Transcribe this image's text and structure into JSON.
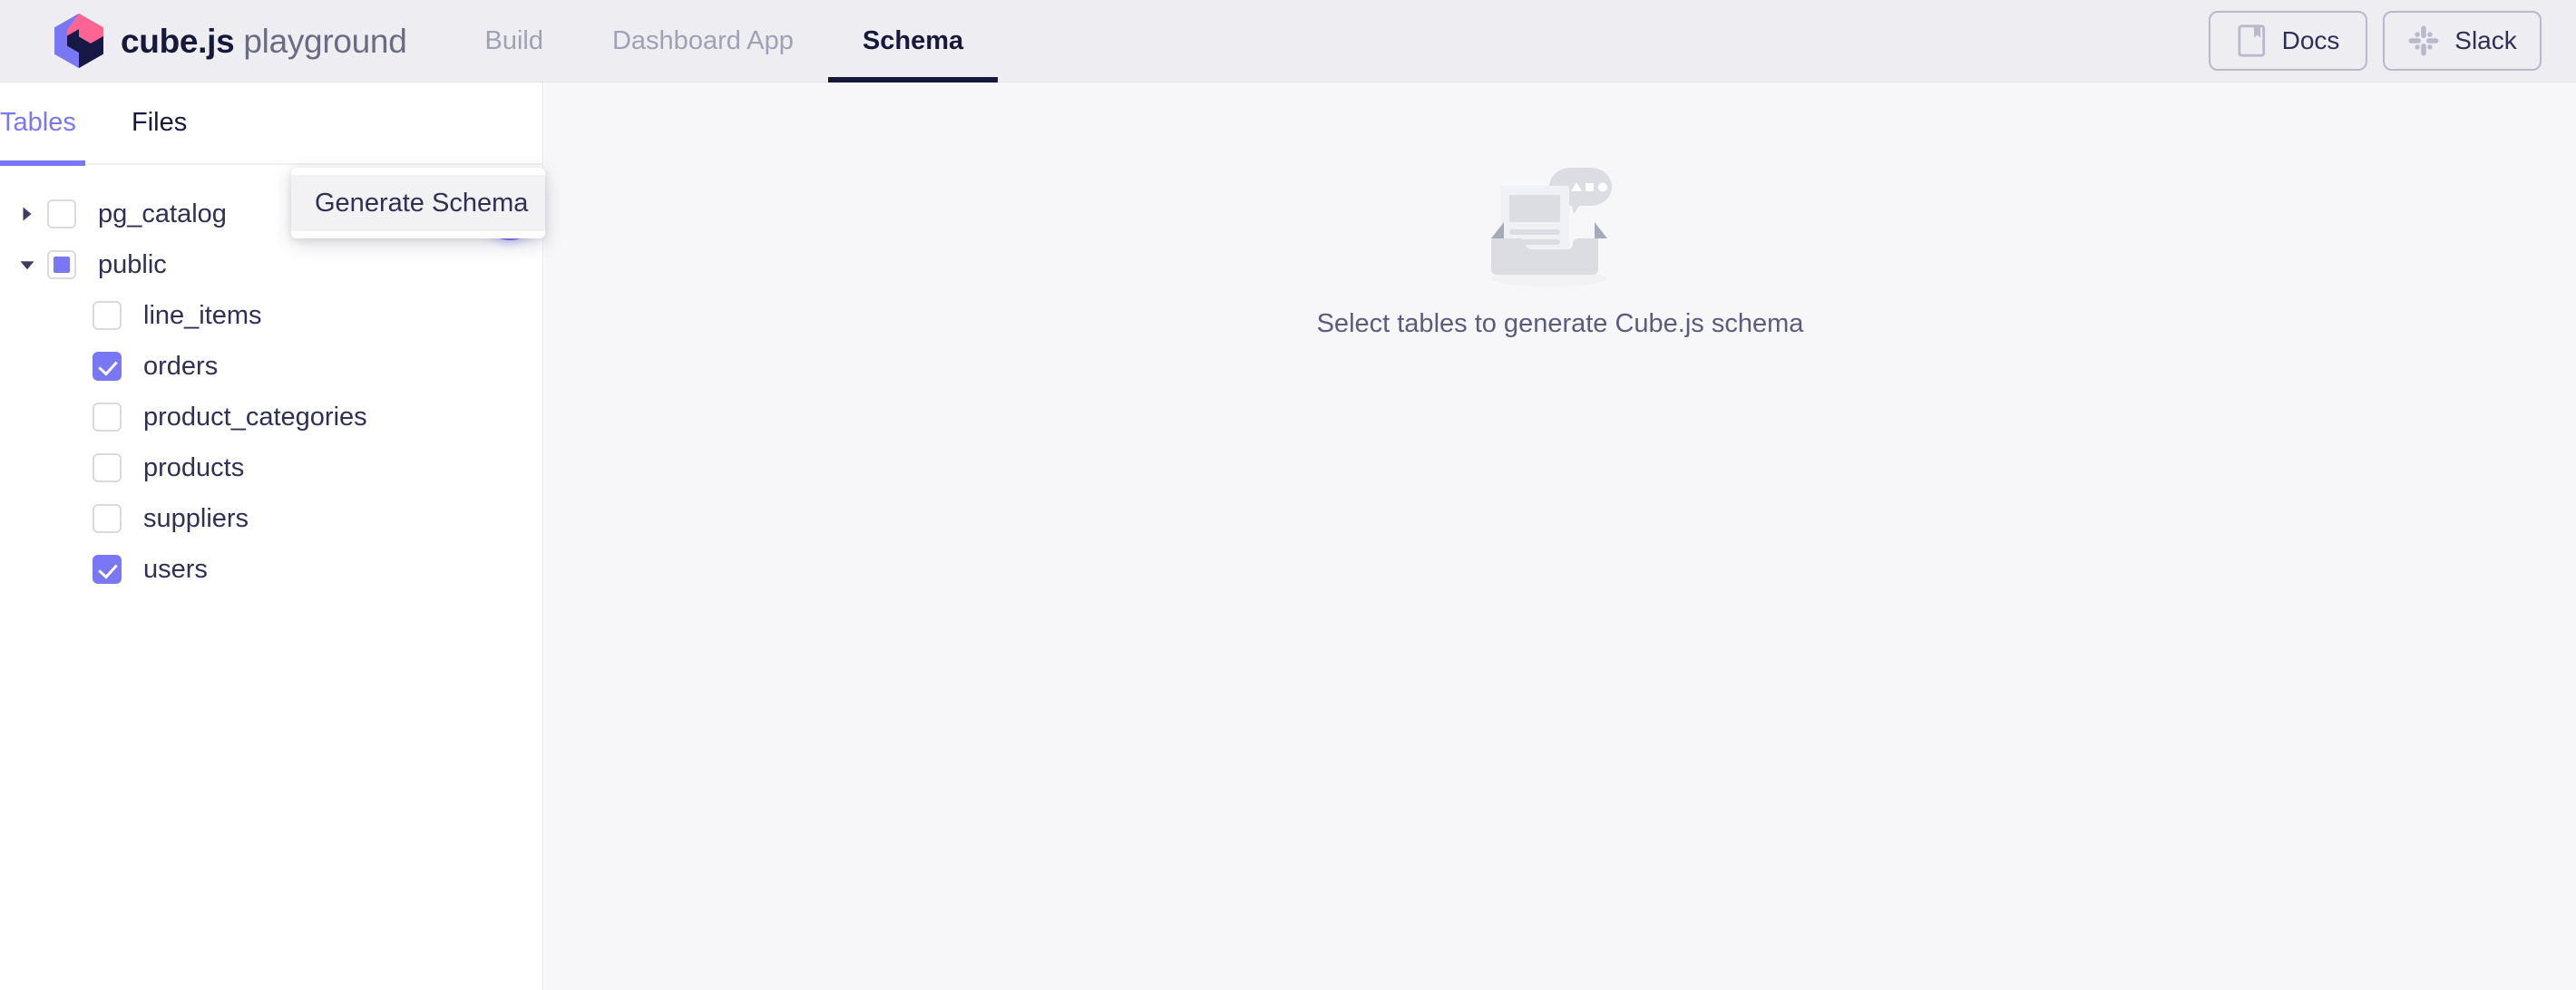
{
  "header": {
    "brand_bold": "cube.js",
    "brand_light": " playground",
    "logo_icon": "cubejs-logo-icon",
    "nav": [
      {
        "label": "Build",
        "active": false
      },
      {
        "label": "Dashboard App",
        "active": false
      },
      {
        "label": "Schema",
        "active": true
      }
    ],
    "actions": [
      {
        "label": "Docs",
        "icon": "book-icon"
      },
      {
        "label": "Slack",
        "icon": "slack-icon"
      }
    ]
  },
  "sidebar": {
    "tabs": [
      {
        "label": "Tables",
        "active": true
      },
      {
        "label": "Files",
        "active": false
      }
    ],
    "add_button_icon": "plus-icon",
    "tree": [
      {
        "label": "pg_catalog",
        "level": 0,
        "expanded": false,
        "caret": "caret-right-icon",
        "checkbox": "unchecked"
      },
      {
        "label": "public",
        "level": 0,
        "expanded": true,
        "caret": "caret-down-icon",
        "checkbox": "indeterminate"
      },
      {
        "label": "line_items",
        "level": 1,
        "checkbox": "unchecked"
      },
      {
        "label": "orders",
        "level": 1,
        "checkbox": "checked"
      },
      {
        "label": "product_categories",
        "level": 1,
        "checkbox": "unchecked"
      },
      {
        "label": "products",
        "level": 1,
        "checkbox": "unchecked"
      },
      {
        "label": "suppliers",
        "level": 1,
        "checkbox": "unchecked"
      },
      {
        "label": "users",
        "level": 1,
        "checkbox": "checked"
      }
    ]
  },
  "dropdown": {
    "visible": true,
    "items": [
      {
        "label": "Generate Schema",
        "hovered": true
      }
    ]
  },
  "main": {
    "empty_illustration": "empty-inbox-icon",
    "empty_text": "Select tables to generate Cube.js schema"
  },
  "colors": {
    "accent": "#7A77F5",
    "brand_dark": "#17193B",
    "header_bg": "#EDEDF2",
    "main_bg": "#F7F7F9",
    "muted_text": "#A1A1B5"
  }
}
